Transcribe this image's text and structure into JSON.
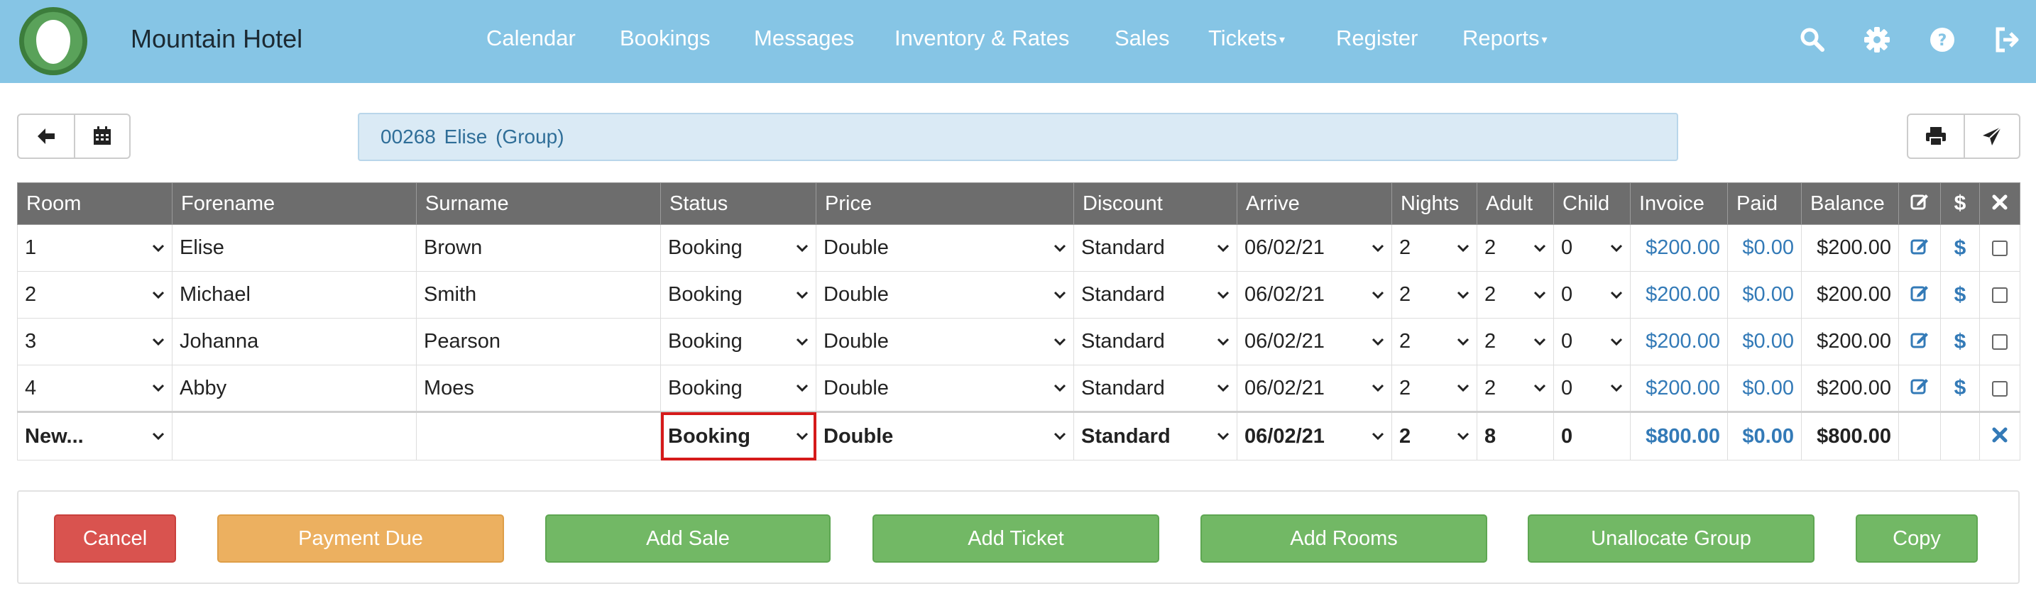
{
  "app": {
    "brand": "Mountain Hotel"
  },
  "nav": {
    "items": [
      "Calendar",
      "Bookings",
      "Messages",
      "Inventory & Rates",
      "Sales",
      "Tickets",
      "Register",
      "Reports"
    ],
    "dropdown_caret": "▾"
  },
  "icons": [
    "search-icon",
    "gear-icon",
    "help-icon",
    "logout-icon",
    "arrow-left-icon",
    "calendar-icon",
    "print-icon",
    "send-icon",
    "edit-icon",
    "dollar-icon",
    "close-icon",
    "chevron-down-icon"
  ],
  "booking": {
    "title": "00268  Elise  (Group)"
  },
  "table": {
    "headers": [
      "Room",
      "Forename",
      "Surname",
      "Status",
      "Price",
      "Discount",
      "Arrive",
      "Nights",
      "Adult",
      "Child",
      "Invoice",
      "Paid",
      "Balance"
    ],
    "rows": [
      {
        "room": "1",
        "forename": "Elise",
        "surname": "Brown",
        "status": "Booking",
        "price": "Double",
        "discount": "Standard",
        "arrive": "06/02/21",
        "nights": "2",
        "adult": "2",
        "child": "0",
        "invoice": "$200.00",
        "paid": "$0.00",
        "balance": "$200.00"
      },
      {
        "room": "2",
        "forename": "Michael",
        "surname": "Smith",
        "status": "Booking",
        "price": "Double",
        "discount": "Standard",
        "arrive": "06/02/21",
        "nights": "2",
        "adult": "2",
        "child": "0",
        "invoice": "$200.00",
        "paid": "$0.00",
        "balance": "$200.00"
      },
      {
        "room": "3",
        "forename": "Johanna",
        "surname": "Pearson",
        "status": "Booking",
        "price": "Double",
        "discount": "Standard",
        "arrive": "06/02/21",
        "nights": "2",
        "adult": "2",
        "child": "0",
        "invoice": "$200.00",
        "paid": "$0.00",
        "balance": "$200.00"
      },
      {
        "room": "4",
        "forename": "Abby",
        "surname": "Moes",
        "status": "Booking",
        "price": "Double",
        "discount": "Standard",
        "arrive": "06/02/21",
        "nights": "2",
        "adult": "2",
        "child": "0",
        "invoice": "$200.00",
        "paid": "$0.00",
        "balance": "$200.00"
      }
    ],
    "new_row": {
      "room": "New...",
      "status": "Booking",
      "price": "Double",
      "discount": "Standard",
      "arrive": "06/02/21",
      "nights": "2",
      "adult": "8",
      "child": "0",
      "invoice": "$800.00",
      "paid": "$0.00",
      "balance": "$800.00"
    }
  },
  "actions": {
    "cancel": "Cancel",
    "payment_due": "Payment Due",
    "add_sale": "Add Sale",
    "add_ticket": "Add Ticket",
    "add_rooms": "Add Rooms",
    "unallocate_group": "Unallocate Group",
    "copy": "Copy"
  },
  "colors": {
    "topbar": "#86c5e5",
    "table_header": "#6d6d6d",
    "link": "#337ab7",
    "cancel": "#d9534f",
    "payment_due": "#ecb060",
    "action_green": "#72b865",
    "focus_outline": "#d51a1a"
  }
}
